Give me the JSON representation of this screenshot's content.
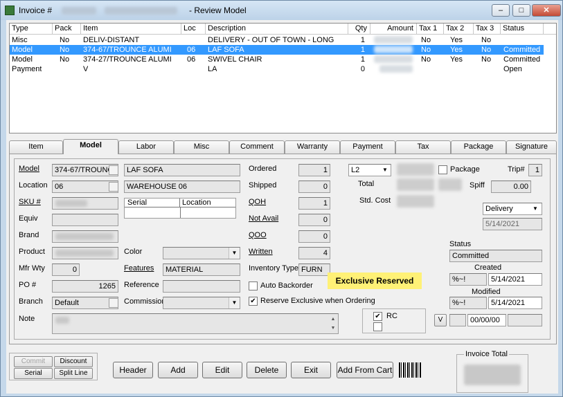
{
  "window": {
    "title_prefix": "Invoice #",
    "title_suffix": "- Review Model",
    "min_label": "–",
    "max_label": "□",
    "close_label": "✕"
  },
  "grid": {
    "headers": [
      "Type",
      "Pack",
      "Item",
      "Loc",
      "Description",
      "Qty",
      "Amount",
      "Tax 1",
      "Tax 2",
      "Tax 3",
      "Status"
    ],
    "rows": [
      {
        "type": "Misc",
        "pack": "No",
        "item": "DELIV-DISTANT",
        "loc": "",
        "description": "DELIVERY - OUT OF TOWN - LONG",
        "qty": "1",
        "tax1": "No",
        "tax2": "Yes",
        "tax3": "No",
        "status": ""
      },
      {
        "type": "Model",
        "pack": "No",
        "item": "374-67/TROUNCE ALUMI",
        "loc": "06",
        "description": "LAF SOFA",
        "qty": "1",
        "tax1": "No",
        "tax2": "Yes",
        "tax3": "No",
        "status": "Committed"
      },
      {
        "type": "Model",
        "pack": "No",
        "item": "374-27/TROUNCE ALUMI",
        "loc": "06",
        "description": "SWIVEL CHAIR",
        "qty": "1",
        "tax1": "No",
        "tax2": "Yes",
        "tax3": "No",
        "status": "Committed"
      },
      {
        "type": "Payment",
        "pack": "",
        "item": "V",
        "loc": "",
        "description": "LA",
        "qty": "0",
        "tax1": "",
        "tax2": "",
        "tax3": "",
        "status": "Open"
      }
    ]
  },
  "tabs": [
    "Item",
    "Model",
    "Labor",
    "Misc",
    "Comment",
    "Warranty",
    "Payment",
    "Tax",
    "Package",
    "Signature"
  ],
  "form": {
    "model_label": "Model",
    "model_value": "374-67/TROUNC",
    "model_desc": "LAF SOFA",
    "location_label": "Location",
    "location_value": "06",
    "location_desc": "WAREHOUSE 06",
    "sku_label": "SKU #",
    "equiv_label": "Equiv",
    "brand_label": "Brand",
    "product_label": "Product",
    "mfr_wty_label": "Mfr Wty",
    "mfr_wty_value": "0",
    "po_label": "PO #",
    "po_value": "1265",
    "branch_label": "Branch",
    "branch_value": "Default",
    "note_label": "Note",
    "serial_header": "Serial",
    "location_header": "Location",
    "color_label": "Color",
    "features_label": "Features",
    "features_value": "MATERIAL",
    "reference_label": "Reference",
    "commission_label": "Commission",
    "ordered_label": "Ordered",
    "ordered_value": "1",
    "shipped_label": "Shipped",
    "shipped_value": "0",
    "qoh_label": "QOH",
    "qoh_value": "1",
    "not_avail_label": "Not Avail",
    "not_avail_value": "0",
    "qoo_label": "QOO",
    "qoo_value": "0",
    "written_label": "Written",
    "written_value": "4",
    "inv_type_label": "Inventory Type",
    "inv_type_value": "FURN",
    "auto_backorder_label": "Auto Backorder",
    "reserve_exclusive_label": "Reserve Exclusive when Ordering",
    "exclusive_reserved": "Exclusive Reserved",
    "price_level": "L2",
    "total_label": "Total",
    "std_cost_label": "Std. Cost",
    "package_label": "Package",
    "trip_label": "Trip#",
    "trip_value": "1",
    "spiff_label": "Spiff",
    "spiff_value": "0.00",
    "delivery_value": "Delivery",
    "delivery_date": "5/14/2021",
    "status_label": "Status",
    "status_value": "Committed",
    "created_label": "Created",
    "created_code": "%~!",
    "created_date": "5/14/2021",
    "modified_label": "Modified",
    "modified_code": "%~!",
    "modified_date": "5/14/2021",
    "v_label": "V",
    "v_date": "00/00/00",
    "rc_label": "RC"
  },
  "buttons": {
    "commit": "Commit",
    "discount": "Discount",
    "serial": "Serial",
    "split_line": "Split Line",
    "header": "Header",
    "add": "Add",
    "edit": "Edit",
    "delete": "Delete",
    "exit": "Exit",
    "add_from_cart": "Add From Cart"
  },
  "invoice_total_label": "Invoice Total",
  "colors": {
    "selection": "#3399ff",
    "exclusive_bg": "#fff176"
  }
}
